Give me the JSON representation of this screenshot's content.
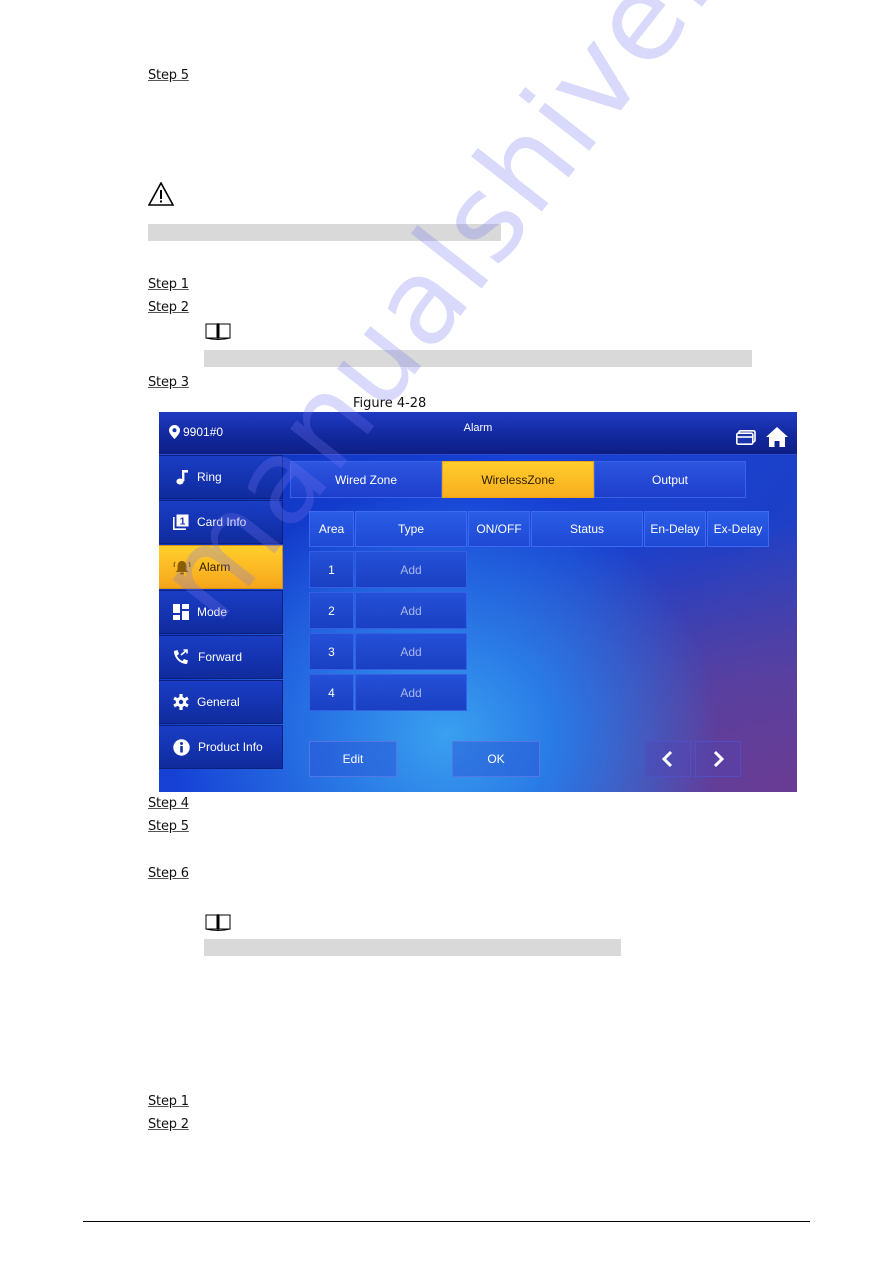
{
  "document": {
    "steps_top": [
      {
        "label": "Step 5"
      }
    ],
    "steps_mid": [
      {
        "label": "Step 1"
      },
      {
        "label": "Step 2"
      },
      {
        "label": "Step 3"
      }
    ],
    "figure_caption": "Figure 4-28",
    "steps_after": [
      {
        "label": "Step 4"
      },
      {
        "label": "Step 5"
      },
      {
        "label": "Step 6"
      }
    ],
    "steps_bottom": [
      {
        "label": "Step 1"
      },
      {
        "label": "Step 2"
      }
    ],
    "watermark": "manualshive.com"
  },
  "device": {
    "location": "9901#0",
    "title": "Alarm",
    "sidebar": [
      {
        "label": "Ring",
        "icon": "music-note-icon"
      },
      {
        "label": "Card Info",
        "icon": "card-icon"
      },
      {
        "label": "Alarm",
        "icon": "bell-icon",
        "active": true
      },
      {
        "label": "Mode",
        "icon": "grid-icon"
      },
      {
        "label": "Forward",
        "icon": "phone-forward-icon"
      },
      {
        "label": "General",
        "icon": "gear-icon"
      },
      {
        "label": "Product Info",
        "icon": "info-icon"
      }
    ],
    "tabs": [
      {
        "label": "Wired Zone"
      },
      {
        "label": "WirelessZone",
        "active": true
      },
      {
        "label": "Output"
      }
    ],
    "table": {
      "headers": [
        "Area",
        "Type",
        "ON/OFF",
        "Status",
        "En-Delay",
        "Ex-Delay"
      ],
      "rows": [
        {
          "area": "1",
          "type": "Add"
        },
        {
          "area": "2",
          "type": "Add"
        },
        {
          "area": "3",
          "type": "Add"
        },
        {
          "area": "4",
          "type": "Add"
        }
      ]
    },
    "buttons": {
      "edit": "Edit",
      "ok": "OK"
    },
    "colors": {
      "accent": "#fbb723",
      "panel": "#1742d6"
    }
  }
}
